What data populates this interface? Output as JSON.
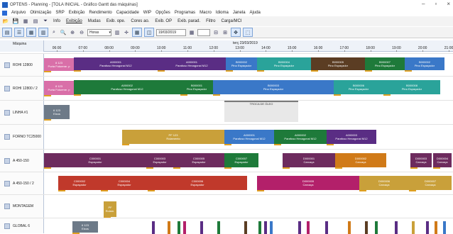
{
  "window": {
    "title": "OPTENS - Planning - [TOLA INICIAL - Gráfico Gantt das máquinas]",
    "controls": [
      "–",
      "▫",
      "×"
    ]
  },
  "menu": [
    "Arquivo",
    "Otimização",
    "SRP",
    "Exibição",
    "Rendimento",
    "Capacidade",
    "WIP",
    "Opções",
    "Programas",
    "Macro",
    "Idioma",
    "Janela",
    "Ajuda"
  ],
  "tabs": [
    "Info",
    "Exibição",
    "Mudas",
    "Exib. ope.",
    "Cores ao.",
    "Exib. OP",
    "Exib. parad.",
    "Filtro",
    "Carga/MCI"
  ],
  "toolbar": {
    "zoom_value": "Horas",
    "date_value": "19/03/2019",
    "lead_value": "",
    "small_value": ""
  },
  "gantt": {
    "machine_header": "Máquina",
    "date": "terç 23/03/2019",
    "hours": [
      "06:00",
      "07:00",
      "08:00",
      "09:00",
      "10:00",
      "11:00",
      "12:00",
      "13:00",
      "14:00",
      "15:00",
      "16:00",
      "17:00",
      "18:00",
      "19:00",
      "20:00",
      "21:00"
    ],
    "rows": [
      {
        "label": "ROHI 12800"
      },
      {
        "label": "ROHI 12800 / 2"
      },
      {
        "label": "LINHA #1"
      },
      {
        "label": "FORNO TC25000"
      },
      {
        "label": "A 450-150"
      },
      {
        "label": "A 450-150 / 2"
      },
      {
        "label": "MONTAGEM"
      },
      {
        "label": "GLOBAL 6"
      }
    ],
    "tasks": {
      "r0": [
        {
          "code": "8",
          "sub": "Porta Fotoeme. p",
          "num": "123"
        },
        {
          "code": "A000001",
          "sub": "Parafuso Hexagonal M12"
        },
        {
          "code": "A000001",
          "sub": "Parafuso Hexagonal M12"
        },
        {
          "code": "B000002",
          "sub": "Pino Espaçador"
        },
        {
          "code": "B000004",
          "sub": "Pino Espaçador"
        },
        {
          "code": "B000005",
          "sub": "Pino Espaçador"
        },
        {
          "code": "B000007",
          "sub": "Pino Espaçador"
        },
        {
          "code": "B000002",
          "sub": "Pino Espaçador"
        }
      ],
      "r1": [
        {
          "code": "8",
          "sub": "Porta Fotoeme. p",
          "num": "123"
        },
        {
          "code": "A000002",
          "sub": "Parafuso Hexagonal M12"
        },
        {
          "code": "B000001",
          "sub": "Pino Espaçador"
        },
        {
          "code": "B000003",
          "sub": "Pino Espaçador"
        },
        {
          "code": "B000006",
          "sub": "Pino Espaçador"
        },
        {
          "code": "B000008",
          "sub": "Pino Espaçador"
        }
      ],
      "r2": [
        {
          "code": "6",
          "sub": "Eixos",
          "num": "123"
        },
        {
          "code": "TROCA DE ÓLEO",
          "sub": ""
        }
      ],
      "r3": [
        {
          "code": "PF",
          "sub": "Rolamento",
          "num": "123"
        },
        {
          "code": "A000001",
          "sub": "Parafuso Hexagonal M12"
        },
        {
          "code": "A000002",
          "sub": "Parafuso Hexagonal M12"
        },
        {
          "code": "A000003",
          "sub": "Parafuso Hexagonal M12"
        }
      ],
      "r4": [
        {
          "code": "C000001",
          "sub": "Espaçador"
        },
        {
          "code": "C000003",
          "sub": "Espaçador"
        },
        {
          "code": "C000005",
          "sub": "Espaçador"
        },
        {
          "code": "C000007",
          "sub": "Espaçador"
        },
        {
          "code": "D000001",
          "sub": "Carcaça"
        },
        {
          "code": "D000002",
          "sub": "Carcaça"
        },
        {
          "code": "D000003",
          "sub": "Carcaça"
        },
        {
          "code": "D000004",
          "sub": "Carcaça"
        }
      ],
      "r5": [
        {
          "code": "C000002",
          "sub": "Espaçador"
        },
        {
          "code": "C000004",
          "sub": "Espaçador"
        },
        {
          "code": "C000006",
          "sub": "Espaçador"
        },
        {
          "code": "D000005",
          "sub": "Carcaça"
        },
        {
          "code": "D000006",
          "sub": "Carcaça"
        },
        {
          "code": "D000007",
          "sub": "Carcaça"
        }
      ],
      "r6": [
        {
          "code": "PF",
          "sub": "Rolam.",
          "num": ""
        }
      ],
      "r7": [
        {
          "code": "6",
          "sub": "Eixos",
          "num": "123"
        }
      ]
    },
    "colors": {
      "purple": "#5a2d84",
      "green": "#1e7a3a",
      "blue": "#3a78c8",
      "brown": "#5b3d23",
      "teal": "#2aa39a",
      "magenta": "#b3206a",
      "plum": "#6d2b5e",
      "orange": "#d07a18",
      "gold": "#c9a03a",
      "red": "#c0392b",
      "pink": "#d96fa8",
      "gray": "#6d7a88"
    }
  }
}
